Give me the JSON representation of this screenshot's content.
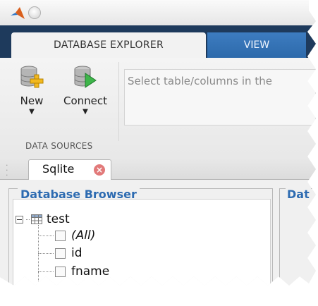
{
  "toolstrip": {
    "tabs": [
      {
        "label": "DATABASE EXPLORER",
        "active": true
      },
      {
        "label": "VIEW",
        "active": false
      }
    ],
    "new_button": {
      "label": "New",
      "icon": "database-plus-icon"
    },
    "connect_button": {
      "label": "Connect",
      "icon": "database-connect-icon"
    },
    "dropdown_glyph": "▼",
    "selection_placeholder": "Select table/columns in the",
    "section_label": "DATA SOURCES"
  },
  "document_tabs": [
    {
      "label": "Sqlite",
      "close_glyph": "×",
      "active": true
    }
  ],
  "database_browser": {
    "title": "Database Browser",
    "tree": {
      "table": "test",
      "columns": [
        "(All)",
        "id",
        "fname"
      ]
    }
  },
  "details_panel": {
    "title_fragment": "Dat"
  },
  "colors": {
    "tab_strip_bg": "#1e3a5c",
    "view_tab_bg": "#3d7cc0",
    "panel_title": "#2d6bb1",
    "close_icon": "#e27a7a",
    "connect_arrow": "#3eb54a",
    "new_plus": "#f2b81e"
  }
}
